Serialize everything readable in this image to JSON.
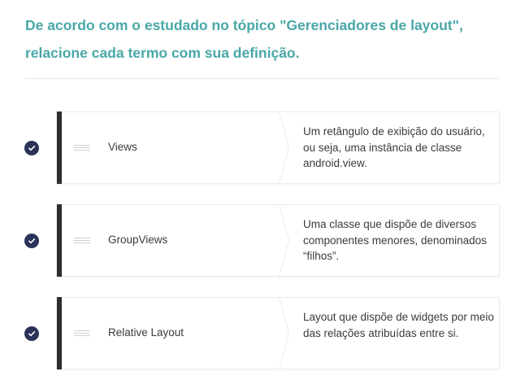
{
  "question": {
    "text": "De acordo com o estudado no tópico \"Gerenciadores de layout\", relacione cada termo com sua definição."
  },
  "colors": {
    "question_text": "#4aa7a7",
    "check_circle": "#2b3458",
    "card_bar": "#2e2e2e"
  },
  "icons": {
    "status": "check-circle-icon",
    "handle": "drag-handle-icon"
  },
  "pairs": [
    {
      "term": "Views",
      "definition": "Um retângulo de exibição do usuário, ou seja, uma instância de classe android.view.",
      "status": "correct"
    },
    {
      "term": "GroupViews",
      "definition": "Uma classe que dispõe de diversos componentes menores, denominados “filhos”.",
      "status": "correct"
    },
    {
      "term": "Relative Layout",
      "definition": "Layout que dispõe de widgets por meio das relações atribuídas entre si.",
      "status": "correct"
    }
  ]
}
